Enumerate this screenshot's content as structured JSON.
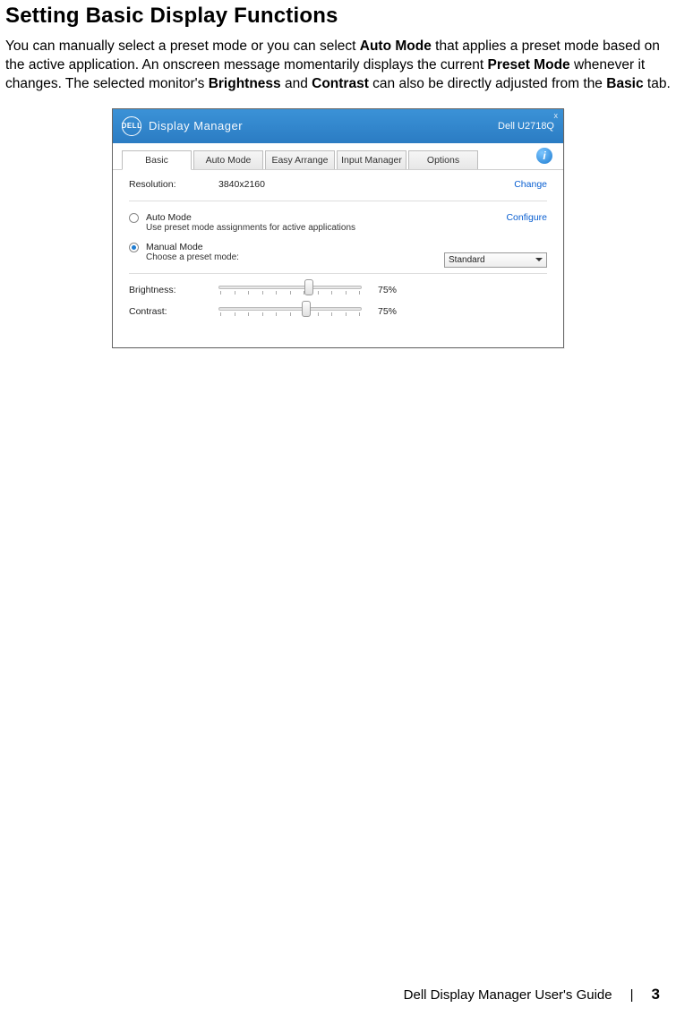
{
  "section_title": "Setting Basic Display Functions",
  "intro": {
    "p1a": "You can manually select a preset mode or you can select ",
    "auto_mode": "Auto Mode",
    "p1b": " that applies a preset mode based on the active application. An onscreen message momentarily displays the current ",
    "preset_mode": "Preset Mode",
    "p1c": " whenever it changes. The selected monitor's ",
    "brightness": "Brightness",
    "p1d": " and ",
    "contrast": "Contrast",
    "p1e": " can also be directly adjusted from the ",
    "basic": "Basic",
    "p1f": " tab."
  },
  "app": {
    "logo_text": "DELL",
    "title": "Display Manager",
    "monitor": "Dell U2718Q",
    "close": "x"
  },
  "tabs": {
    "basic": "Basic",
    "auto": "Auto Mode",
    "easy": "Easy Arrange",
    "input": "Input Manager",
    "options": "Options"
  },
  "info_glyph": "i",
  "resolution": {
    "label": "Resolution:",
    "value": "3840x2160",
    "change": "Change"
  },
  "modes": {
    "auto": {
      "title": "Auto Mode",
      "sub": "Use preset mode assignments for active applications"
    },
    "manual": {
      "title": "Manual Mode",
      "sub": "Choose a preset mode:"
    },
    "configure": "Configure",
    "preset_selected": "Standard"
  },
  "sliders": {
    "brightness": {
      "label": "Brightness:",
      "value": "75%",
      "pos": 0.6
    },
    "contrast": {
      "label": "Contrast:",
      "value": "75%",
      "pos": 0.58
    }
  },
  "footer": {
    "guide": "Dell Display Manager User's Guide",
    "divider": "|",
    "page": "3"
  }
}
